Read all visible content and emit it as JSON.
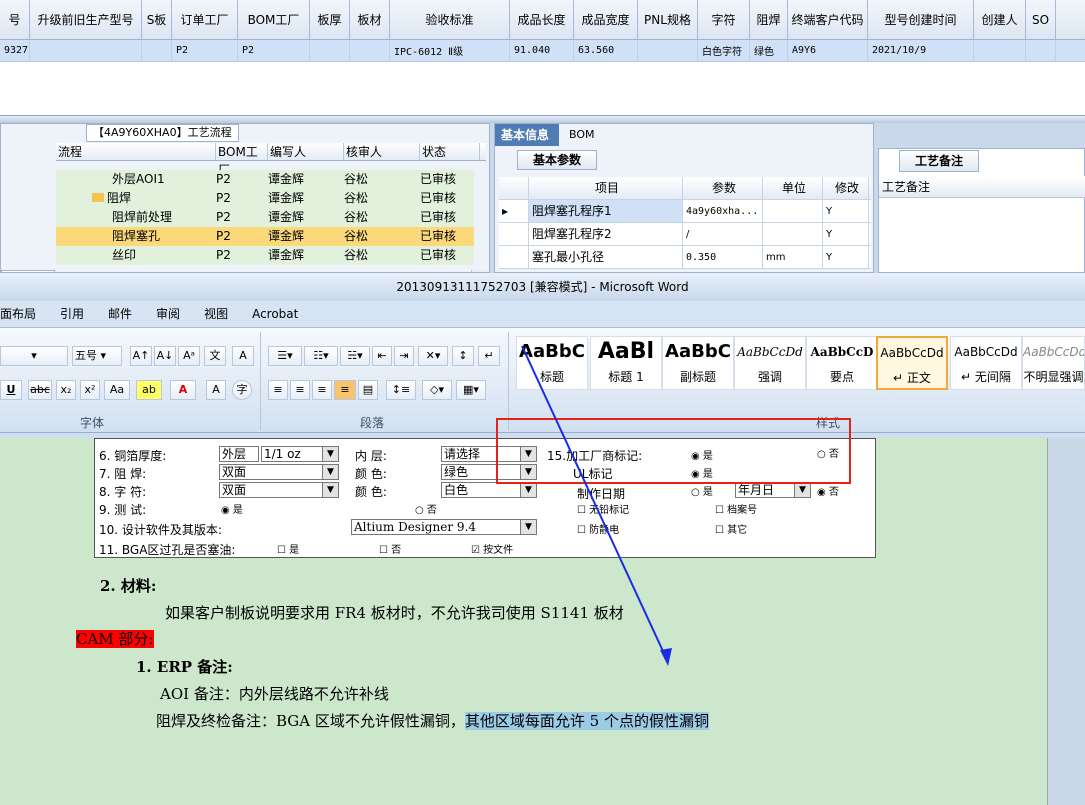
{
  "top_grid": {
    "headers": [
      "号",
      "升级前旧生产型号",
      "S板",
      "订单工厂",
      "BOM工厂",
      "板厚",
      "板材",
      "验收标准",
      "成品长度",
      "成品宽度",
      "PNL规格",
      "字符",
      "阻焊",
      "终端客户代码",
      "型号创建时间",
      "创建人",
      "SO"
    ],
    "row": [
      "9327",
      "",
      "",
      "P2",
      "P2",
      "",
      "",
      "IPC-6012 Ⅱ级",
      "91.040",
      "63.560",
      "",
      "白色字符",
      "绿色",
      "A9Y6",
      "2021/10/9",
      "",
      ""
    ]
  },
  "process_panel": {
    "title": "【4A9Y60XHA0】工艺流程",
    "columns": [
      "流程",
      "BOM工厂",
      "编写人",
      "核审人",
      "状态"
    ],
    "rows": [
      {
        "name": "外层AOI1",
        "factory": "P2",
        "writer": "谭金辉",
        "reviewer": "谷松",
        "status": "已审核"
      },
      {
        "name": "阻焊",
        "factory": "P2",
        "writer": "谭金辉",
        "reviewer": "谷松",
        "status": "已审核"
      },
      {
        "name": "阻焊前处理",
        "factory": "P2",
        "writer": "谭金辉",
        "reviewer": "谷松",
        "status": "已审核"
      },
      {
        "name": "阻焊塞孔",
        "factory": "P2",
        "writer": "谭金辉",
        "reviewer": "谷松",
        "status": "已审核"
      },
      {
        "name": "丝印",
        "factory": "P2",
        "writer": "谭金辉",
        "reviewer": "谷松",
        "status": "已审核"
      }
    ]
  },
  "basic_panel": {
    "tab_active": "基本信息",
    "tab_other": "BOM",
    "subtab": "基本参数",
    "columns": [
      "项目",
      "参数",
      "单位",
      "修改"
    ],
    "rows": [
      {
        "item": "阻焊塞孔程序1",
        "param": "4a9y60xha...",
        "unit": "",
        "mod": "Y"
      },
      {
        "item": "阻焊塞孔程序2",
        "param": "/",
        "unit": "",
        "mod": "Y"
      },
      {
        "item": "塞孔最小孔径",
        "param": "0.350",
        "unit": "mm",
        "mod": "Y"
      }
    ]
  },
  "remark_panel": {
    "tab": "工艺备注",
    "column": "工艺备注"
  },
  "word": {
    "title": "20130913111752703 [兼容模式] - Microsoft Word",
    "tabs": [
      "面布局",
      "引用",
      "邮件",
      "审阅",
      "视图",
      "Acrobat"
    ],
    "font_size": "五号",
    "group_font": "字体",
    "group_paragraph": "段落",
    "group_styles": "样式",
    "styles": [
      {
        "sample": "AaBbC",
        "name": "标题"
      },
      {
        "sample": "AaBl",
        "name": "标题 1"
      },
      {
        "sample": "AaBbC",
        "name": "副标题"
      },
      {
        "sample": "AaBbCcDd",
        "name": "强调"
      },
      {
        "sample": "AaBbCcD",
        "name": "要点"
      },
      {
        "sample": "AaBbCcDd",
        "name": "正文"
      },
      {
        "sample": "AaBbCcDd",
        "name": "无间隔"
      },
      {
        "sample": "AaBbCcDd",
        "name": "不明显强调"
      }
    ],
    "form": {
      "r1": [
        "6. 铜箔厚度:",
        "外层",
        "1/1 oz",
        "内  层:",
        "请选择",
        "15.加工厂商标记:",
        "是",
        "否"
      ],
      "r2": [
        "7. 阻  焊:",
        "双面",
        "颜  色:",
        "绿色",
        "UL标记",
        "是"
      ],
      "r3": [
        "8. 字  符:",
        "双面",
        "颜  色:",
        "白色",
        "制作日期",
        "是",
        "年月日",
        "否"
      ],
      "r4": [
        "9. 测  试:",
        "是",
        "否",
        "无铅标记",
        "档案号"
      ],
      "r5": [
        "10. 设计软件及其版本:",
        "Altium Designer 9.4",
        "防静电",
        "其它"
      ],
      "r6": [
        "11. BGA区过孔是否塞油:",
        "是",
        "否",
        "按文件"
      ]
    },
    "doc": {
      "h2": "2. 材料:",
      "p_material": "如果客户制板说明要求用 FR4 板材时，不允许我司使用 S1141 板材",
      "cam": "CAM 部分:",
      "h_erp": "1. ERP 备注:",
      "p_aoi": "AOI 备注：内外层线路不允许补线",
      "p_solder_a": "阻焊及终检备注：BGA 区域不允许假性漏铜，",
      "p_solder_b": "其他区域每面允许 5 个点的假性漏铜"
    }
  }
}
